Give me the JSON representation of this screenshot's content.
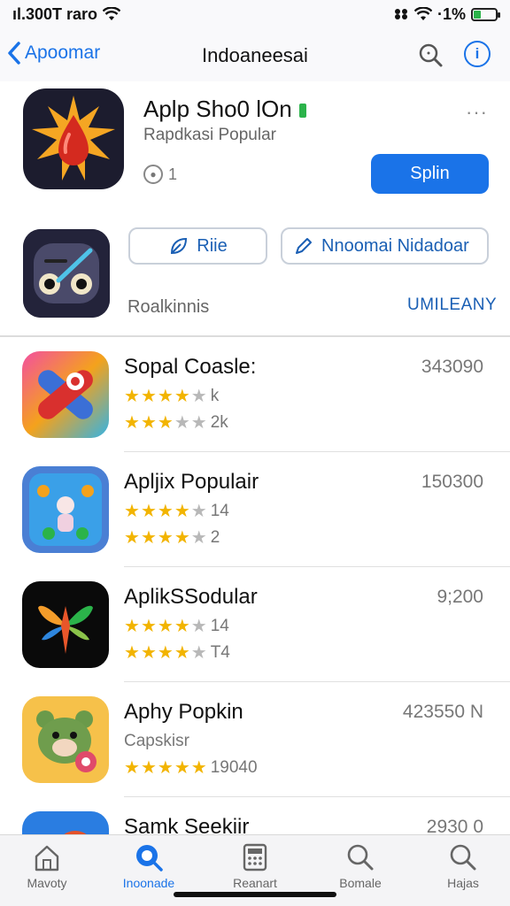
{
  "status_bar": {
    "carrier": "ıl.300T raro",
    "battery_pct": "·1%",
    "battery_level": 0.35
  },
  "nav": {
    "back_label": "Apoomar",
    "title": "Indoaneesai"
  },
  "featured": {
    "title": "Aplp Sho0 lOn",
    "subtitle": "Rapdkasi Popular",
    "rating_count": "1",
    "get_label": "Splin",
    "more": "···",
    "pill_1": "Riie",
    "pill_2": "Nnoomai Nidadoar",
    "section_label": "Roalkinnis",
    "section_link": "UMILEANY"
  },
  "list": [
    {
      "name": "Sopal Coasle:",
      "count": "343090",
      "line1_text": "k",
      "line1_stars": 3.5,
      "line2_text": "2k",
      "line2_stars": 3
    },
    {
      "name": "Apljix Populair",
      "count": "150300",
      "line1_text": "14",
      "line1_stars": 4,
      "line2_text": "2",
      "line2_stars": 3.5
    },
    {
      "name": "AplikSSodular",
      "count": "9;200",
      "line1_text": "14",
      "line1_stars": 3.5,
      "line2_text": "T4",
      "line2_stars": 3.5
    },
    {
      "name": "Aphy Popkin",
      "count": "423550 N",
      "sub": "Capskisr",
      "line2_text": "19040",
      "line2_stars": 4.5
    },
    {
      "name": "Samk Seekiir",
      "count": "2930 0"
    }
  ],
  "tabs": [
    {
      "label": "Mavoty",
      "icon": "home-icon"
    },
    {
      "label": "Inoonade",
      "icon": "search-circle-icon",
      "active": true
    },
    {
      "label": "Reanart",
      "icon": "calculator-icon"
    },
    {
      "label": "Bomale",
      "icon": "search-icon"
    },
    {
      "label": "Hajas",
      "icon": "search-icon"
    }
  ],
  "colors": {
    "accent": "#1a73e8",
    "star": "#f2b400"
  }
}
